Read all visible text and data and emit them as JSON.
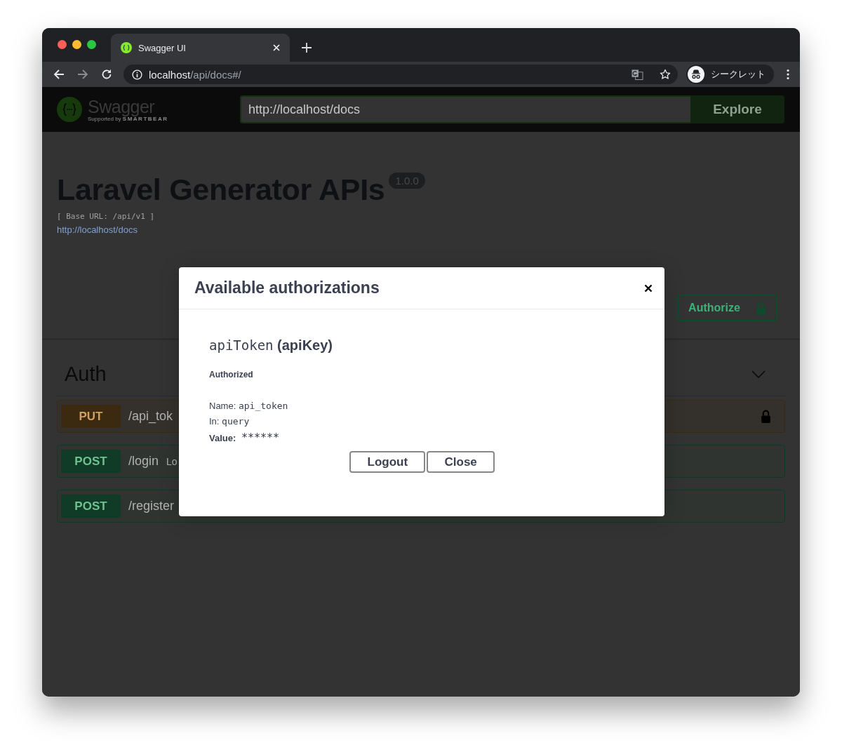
{
  "browser": {
    "tab": {
      "title": "Swagger UI"
    },
    "address": {
      "host": "localhost",
      "path": "/api/docs#/"
    },
    "profile": {
      "label": "シークレット"
    }
  },
  "topbar": {
    "brand": "Swagger",
    "tagline_prefix": "Supported by",
    "tagline_brand": "SMARTBEAR",
    "url_field": {
      "value": "http://localhost/docs"
    },
    "explore_button": "Explore"
  },
  "info": {
    "title": "Laravel Generator APIs",
    "version": "1.0.0",
    "base_url": "[ Base URL: /api/v1 ]",
    "link": "http://localhost/docs"
  },
  "authorize_button": {
    "label": "Authorize",
    "locked": true
  },
  "tag": {
    "name": "Auth",
    "expanded": true
  },
  "operations": [
    {
      "method": "PUT",
      "path": "/api_tok",
      "locked": true
    },
    {
      "method": "POST",
      "path": "/login",
      "summary": "Lo",
      "locked": false
    },
    {
      "method": "POST",
      "path": "/register",
      "locked": false
    }
  ],
  "modal": {
    "title": "Available authorizations",
    "scheme": {
      "name": "apiToken",
      "type": "(apiKey)",
      "status": "Authorized",
      "fields": [
        {
          "label": "Name:",
          "value": "api_token",
          "bold_label": false
        },
        {
          "label": "In:",
          "value": "query",
          "bold_label": false
        },
        {
          "label": "Value:",
          "value": "******",
          "bold_label": true
        }
      ]
    },
    "buttons": [
      "Logout",
      "Close"
    ]
  }
}
